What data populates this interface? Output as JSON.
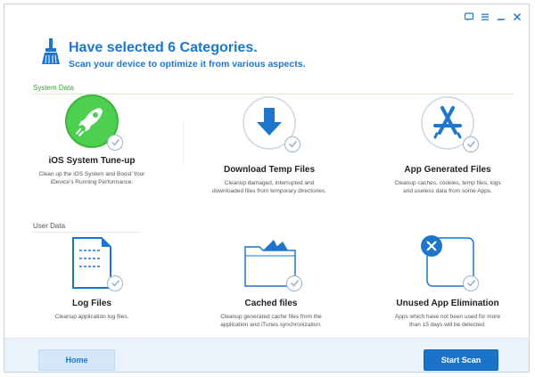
{
  "header": {
    "title": "Have selected 6 Categories.",
    "subtitle": "Scan your device to optimize it from various aspects."
  },
  "sections": {
    "system": {
      "label": "System Data"
    },
    "user": {
      "label": "User Data"
    }
  },
  "items": [
    {
      "name": "iOS System Tune-up",
      "desc": "Clean up the iOS System and Boost Your iDevice's Running Performance.",
      "icon": "rocket-icon"
    },
    {
      "name": "Download Temp Files",
      "desc": "Cleanup damaged, interrupted and downloaded files from temporary directories.",
      "icon": "download-icon"
    },
    {
      "name": "App Generated Files",
      "desc": "Cleanup caches, cookies, temp files, logs and useless data from some Apps.",
      "icon": "app-store-icon"
    },
    {
      "name": "Log Files",
      "desc": "Cleanup application log files.",
      "icon": "document-icon"
    },
    {
      "name": "Cached files",
      "desc": "Cleanup generated cache files from the application and iTunes synchronization.",
      "icon": "folder-icon"
    },
    {
      "name": "Unused App Elimination",
      "desc": "Apps which have not been used for more than 15 days will be detected.",
      "icon": "close-app-icon"
    }
  ],
  "footer": {
    "home_label": "Home",
    "scan_label": "Start Scan"
  },
  "colors": {
    "accent": "#1d76cc",
    "green": "#3aa53a"
  }
}
